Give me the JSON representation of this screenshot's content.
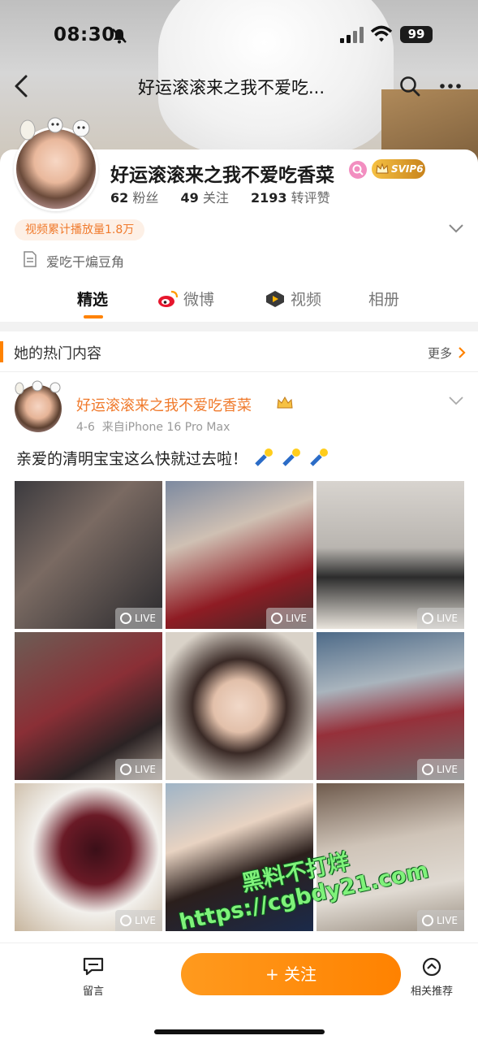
{
  "status_bar": {
    "time": "08:30",
    "battery": "99"
  },
  "nav": {
    "title": "好运滚滚来之我不爱吃..."
  },
  "profile": {
    "username": "好运滚滚来之我不爱吃香菜",
    "svip": "SVIP6",
    "stats": [
      {
        "value": "62",
        "label": "粉丝"
      },
      {
        "value": "49",
        "label": "关注"
      },
      {
        "value": "2193",
        "label": "转评赞"
      }
    ],
    "play_count": "视频累计播放量1.8万",
    "bio": "爱吃干煸豆角"
  },
  "tabs": [
    {
      "label": "精选",
      "active": true
    },
    {
      "label": "微博",
      "active": false
    },
    {
      "label": "视频",
      "active": false
    },
    {
      "label": "相册",
      "active": false
    }
  ],
  "section": {
    "title": "她的热门内容",
    "more": "更多"
  },
  "post": {
    "user": "好运滚滚来之我不爱吃香菜",
    "date": "4-6",
    "source": "来自iPhone 16 Pro Max",
    "text": "亲爱的清明宝宝这么快就过去啦！",
    "live_label": "LIVE",
    "photos": [
      "selfie-two-women",
      "boy-and-woman",
      "mirror-selfie",
      "massage-chair-woman",
      "woman-portrait",
      "massage-chair-room",
      "cherries-bowl",
      "car-selfie",
      "toddler-room"
    ]
  },
  "watermark": {
    "line1": "黑料不打烊",
    "line2": "https://cgbdy21.com"
  },
  "bottom_bar": {
    "comment": "留言",
    "follow": "+ 关注",
    "related": "相关推荐"
  },
  "colors": {
    "accent": "#ff8200",
    "orange_text": "#f07a2c"
  }
}
